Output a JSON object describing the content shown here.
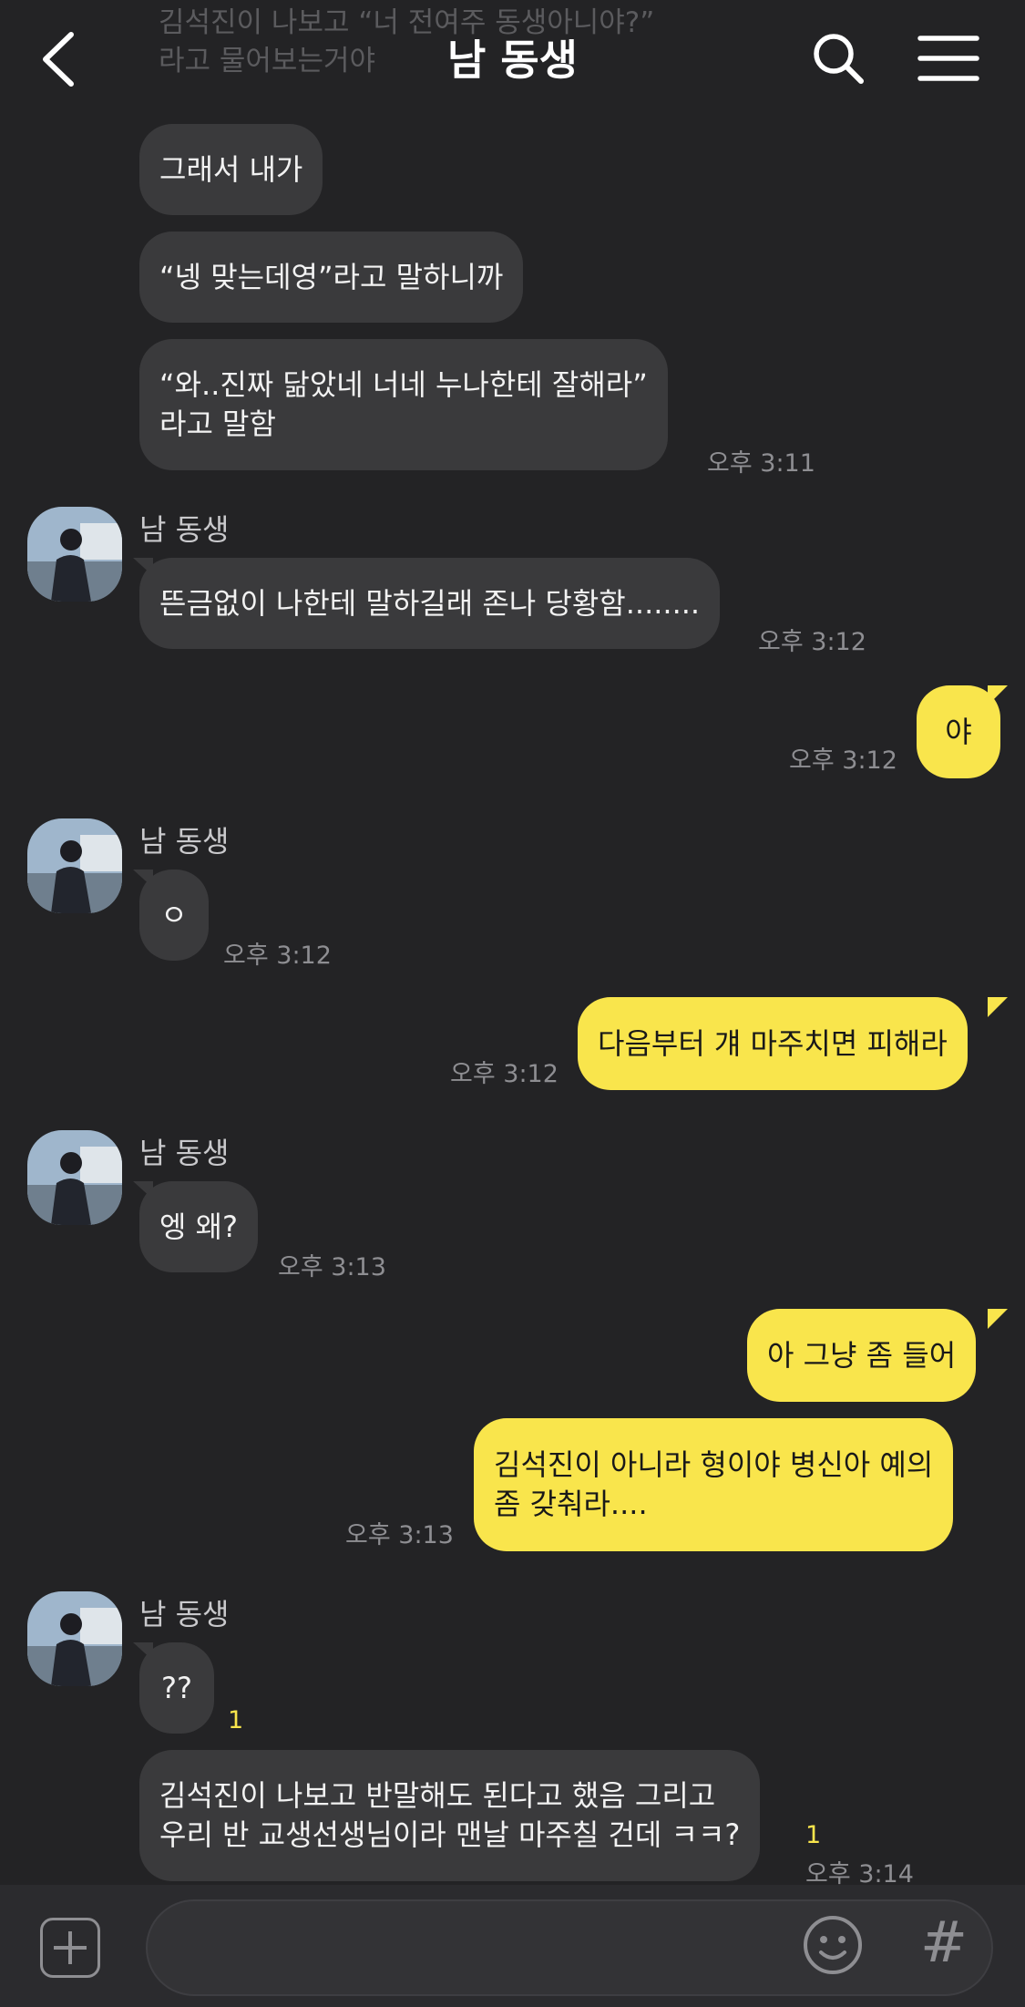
{
  "header": {
    "title": "남 동생",
    "faded_message_lines": [
      "김석진이 나보고 “너 전여주 동생아니야?”",
      "라고 물어보는거야"
    ]
  },
  "messages": [
    {
      "text": "그래서 내가"
    },
    {
      "text": "“넹 맞는데영”라고 말하니까"
    },
    {
      "lines": [
        "“와..진짜 닮았네 너네 누나한테 잘해라”",
        "라고 말함"
      ],
      "time": "오후 3:11"
    },
    {
      "sender": "남 동생",
      "text": "뜬금없이 나한테 말하길래 존나 당황함........",
      "time": "오후 3:12"
    },
    {
      "text": "야",
      "time": "오후 3:12"
    },
    {
      "sender": "남 동생",
      "text": "ㅇ",
      "time": "오후 3:12"
    },
    {
      "text": "다음부터 걔 마주치면 피해라",
      "time": "오후 3:12"
    },
    {
      "sender": "남 동생",
      "text": "엥 왜?",
      "time": "오후 3:13"
    },
    {
      "text": "아 그냥 좀 들어"
    },
    {
      "lines": [
        "김석진이 아니라 형이야 병신아 예의",
        "좀 갖춰라...."
      ],
      "time": "오후 3:13"
    },
    {
      "sender": "남 동생",
      "text": "??",
      "unread": "1"
    },
    {
      "lines": [
        "김석진이 나보고 반말해도 된다고 했음 그리고",
        "우리 반 교생선생님이라 맨날 마주칠 건데 ㅋㅋ?"
      ],
      "unread": "1",
      "time": "오후 3:14"
    }
  ],
  "input": {
    "value": "",
    "placeholder": ""
  },
  "icons": {
    "back": "back-arrow-icon",
    "search": "search-icon",
    "menu": "hamburger-menu-icon",
    "plus": "plus-icon",
    "emoji": "emoji-icon",
    "hash": "hashtag-icon",
    "hash_glyph": "#"
  },
  "colors": {
    "background": "#232325",
    "incoming_bubble": "#3a3a3c",
    "outgoing_bubble": "#f9e54c",
    "unread": "#f9e54c"
  }
}
